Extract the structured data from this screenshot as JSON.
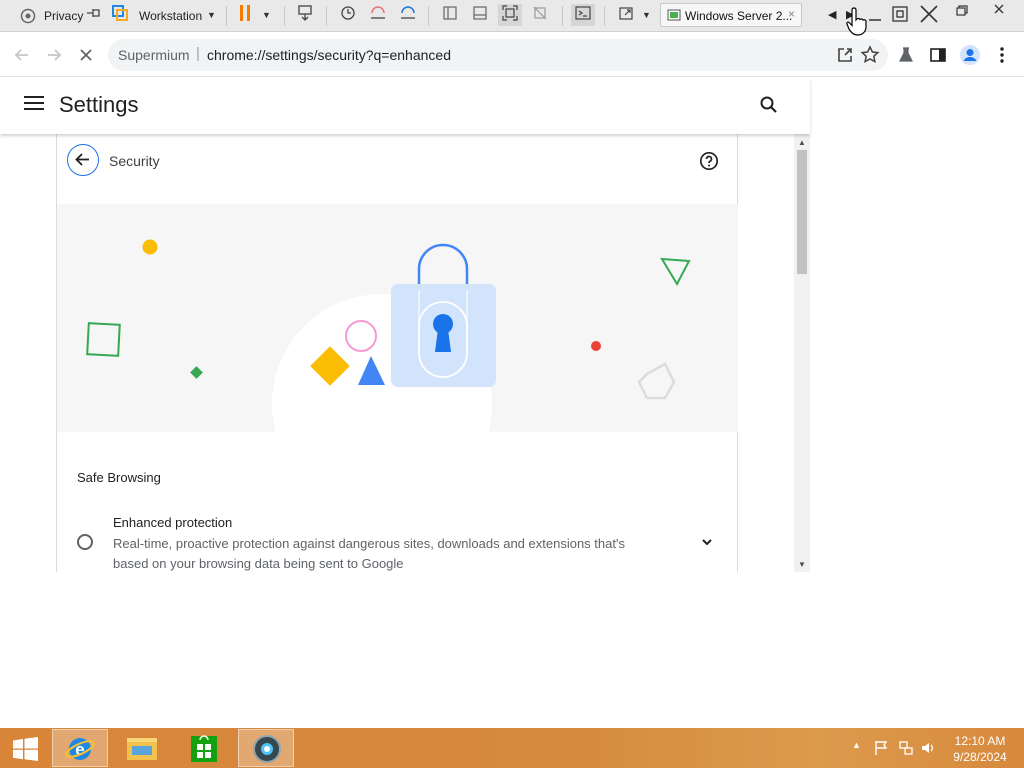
{
  "vmware": {
    "partial_tab_label": "Privacy",
    "vm_menu_label": "Workstation",
    "vm_tab_label": "Windows Server 2...",
    "tab_close": "×"
  },
  "browser": {
    "site_name": "Supermium",
    "separator": "|",
    "url": "chrome://settings/security?q=enhanced"
  },
  "settings": {
    "title": "Settings",
    "page_title": "Security",
    "section_title": "Safe Browsing",
    "option": {
      "title": "Enhanced protection",
      "description": "Real-time, proactive protection against dangerous sites, downloads and extensions that's based on your browsing data being sent to Google",
      "selected": false
    }
  },
  "taskbar": {
    "apps": [
      "start-icon",
      "internet-explorer-icon",
      "file-explorer-icon",
      "store-icon",
      "supermium-icon"
    ],
    "active_app": "supermium-icon",
    "time": "12:10 AM",
    "date": "9/28/2024"
  },
  "colors": {
    "accent": "#1a73e8",
    "taskbar": "#d8853a",
    "lock_body": "#d2e3fc",
    "keyhole": "#1a73e8"
  }
}
